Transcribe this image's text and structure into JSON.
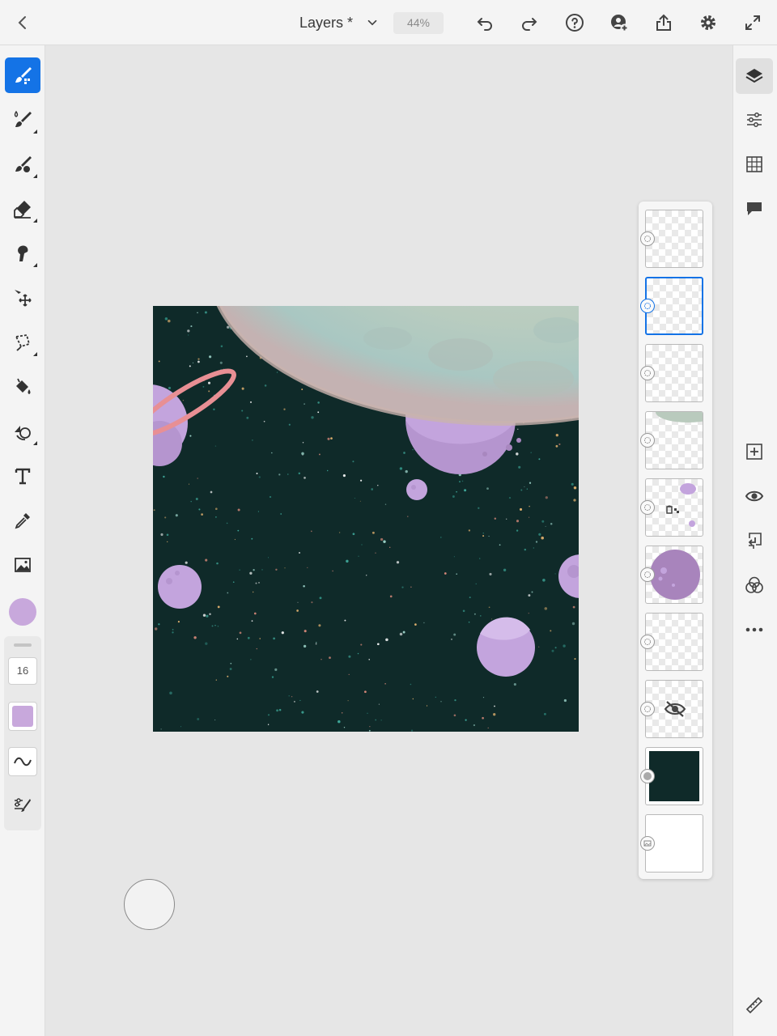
{
  "header": {
    "document_title": "Layers *",
    "zoom_level": "44%",
    "icons": [
      "back-icon",
      "chevron-down-icon",
      "undo-icon",
      "redo-icon",
      "help-icon",
      "invite-icon",
      "share-icon",
      "settings-icon",
      "fullscreen-icon"
    ]
  },
  "tools": {
    "items": [
      "pixel-brush",
      "live-brush",
      "vector-brush",
      "eraser",
      "smudge",
      "move",
      "lasso-selection",
      "fill",
      "transform",
      "type",
      "eyedropper",
      "place-image"
    ],
    "active": "pixel-brush",
    "current_color": "#c8a8dc"
  },
  "tool_options": {
    "brush_size": "16",
    "brush_color": "#c8a8dc"
  },
  "canvas": {
    "background_color": "#0f2a29",
    "planet_color": "#c8a8dc",
    "moon_color": "#c9d6c6"
  },
  "layers": {
    "count": 10,
    "selected_index": 1
  },
  "right_toolbar": {
    "items": [
      "layers-icon",
      "layer-properties-icon",
      "grid-icon",
      "comments-icon",
      "add-layer-icon",
      "visibility-icon",
      "merge-down-icon",
      "blend-mode-icon",
      "more-icon"
    ],
    "footer": "ruler-icon"
  },
  "colors": {
    "accent": "#1473e6",
    "panel_bg": "#f4f4f4",
    "workspace_bg": "#e6e6e6"
  }
}
